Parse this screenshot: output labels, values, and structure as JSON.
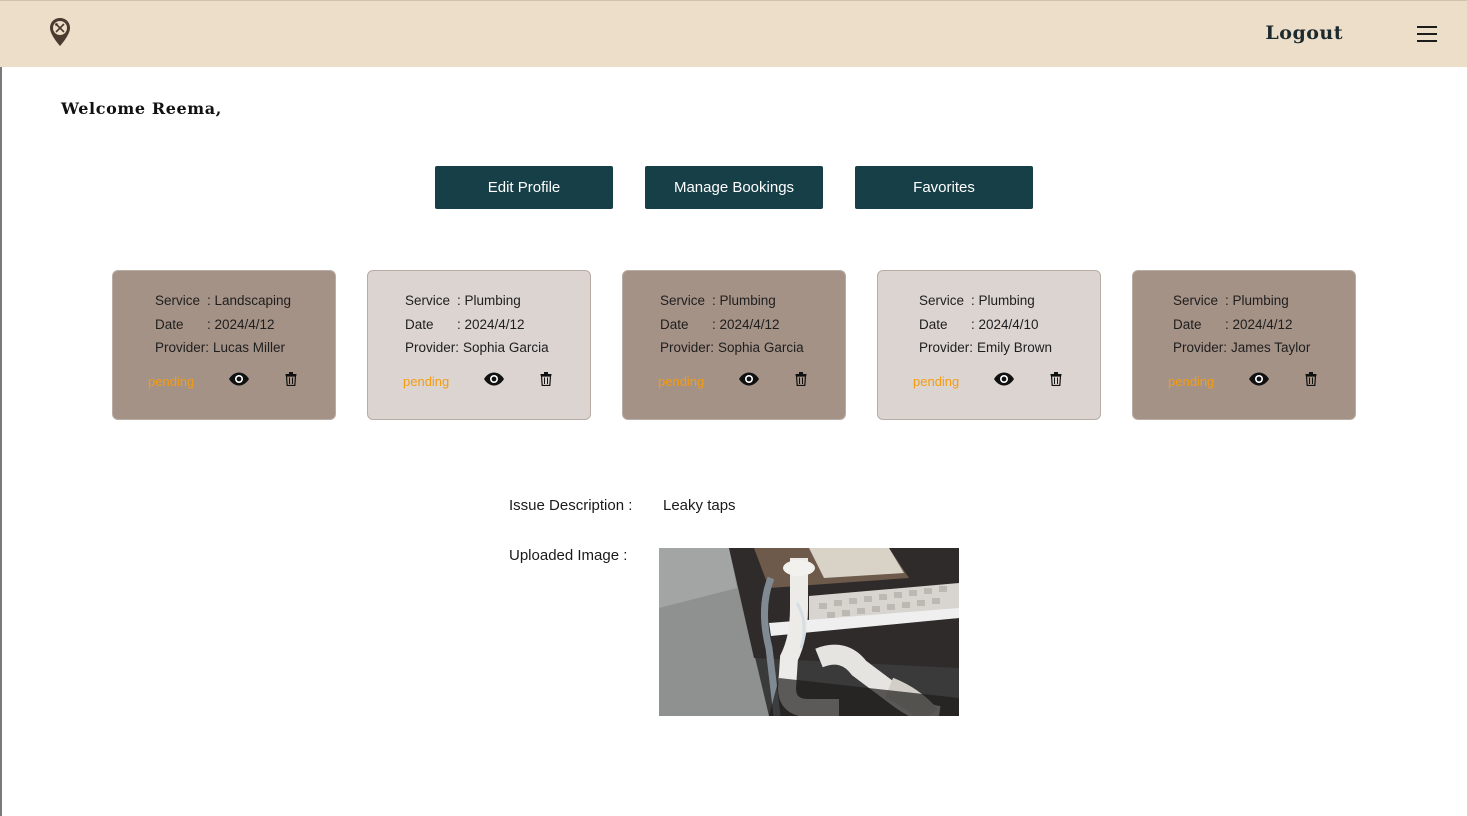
{
  "header": {
    "logout_label": "Logout",
    "logo_icon": "map-pin-tools-icon",
    "menu_icon": "hamburger-menu-icon"
  },
  "welcome": {
    "text": "Welcome Reema,"
  },
  "actions": {
    "edit_profile": "Edit Profile",
    "manage_bookings": "Manage Bookings",
    "favorites": "Favorites"
  },
  "labels": {
    "service": "Service",
    "date": "Date",
    "provider": "Provider:"
  },
  "bookings": [
    {
      "service": ": Landscaping",
      "date": ": 2024/4/12",
      "provider": "Lucas Miller",
      "status": "pending",
      "theme": "dark"
    },
    {
      "service": ": Plumbing",
      "date": ": 2024/4/12",
      "provider": "Sophia Garcia",
      "status": "pending",
      "theme": "light"
    },
    {
      "service": ": Plumbing",
      "date": ": 2024/4/12",
      "provider": "Sophia Garcia",
      "status": "pending",
      "theme": "dark"
    },
    {
      "service": ": Plumbing",
      "date": ": 2024/4/10",
      "provider": "Emily Brown",
      "status": "pending",
      "theme": "light"
    },
    {
      "service": ": Plumbing",
      "date": ": 2024/4/12",
      "provider": "James Taylor",
      "status": "pending",
      "theme": "dark"
    }
  ],
  "details": {
    "issue_label": "Issue Description :",
    "issue_value": "Leaky taps",
    "image_label": "Uploaded Image :",
    "image_subject": "leaking-sink-drain-pipe"
  },
  "colors": {
    "navbar": "#ecdec9",
    "button": "#163f48",
    "card_dark": "#a59287",
    "card_light": "#dcd4d1",
    "status": "#f39c12"
  }
}
